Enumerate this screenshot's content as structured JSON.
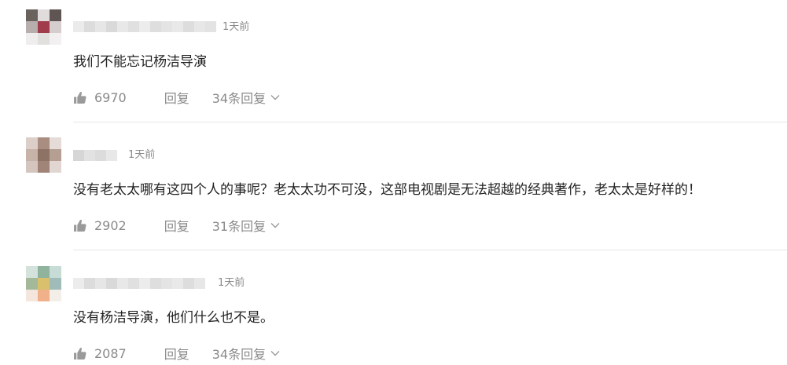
{
  "comments": [
    {
      "time": "1天前",
      "text": "我们不能忘记杨洁导演",
      "likes": "6970",
      "reply_label": "回复",
      "replies_label": "34条回复",
      "avatar_colors": [
        "#6a625c",
        "#e0dcdc",
        "#5f5653",
        "#b8aeae",
        "#a13c4c",
        "#d6cece",
        "#efeded",
        "#e2dfdf",
        "#f2f0f0"
      ],
      "name_colors": [
        "#ebebeb",
        "#dcdcdc",
        "#e6e6e6",
        "#d9d9d9",
        "#e8e8e8",
        "#e0e0e0",
        "#ececec",
        "#dedede",
        "#e4e4e4",
        "#e9e9e9",
        "#dddddd",
        "#e7e7e7",
        "#e3e3e3"
      ]
    },
    {
      "time": "1天前",
      "text": "没有老太太哪有这四个人的事呢？老太太功不可没，这部电视剧是无法超越的经典著作，老太太是好样的！",
      "likes": "2902",
      "reply_label": "回复",
      "replies_label": "31条回复",
      "avatar_colors": [
        "#dccfc9",
        "#a98d80",
        "#e5dcd8",
        "#c8b3a8",
        "#8c7366",
        "#b59e92",
        "#d4c6bf",
        "#a08478",
        "#e1d6d1"
      ],
      "name_colors": [
        "#d6d6d6",
        "#e2e2e2",
        "#dcdcdc",
        "#e8e8e8"
      ]
    },
    {
      "time": "1天前",
      "text": "没有杨洁导演，他们什么也不是。",
      "likes": "2087",
      "reply_label": "回复",
      "replies_label": "34条回复",
      "avatar_colors": [
        "#d4e2dc",
        "#8fb39d",
        "#c7dcd7",
        "#a4b89a",
        "#d8c06d",
        "#9fbcb8",
        "#f4e6dc",
        "#f0b08a",
        "#f4eee9"
      ],
      "name_colors": [
        "#ececec",
        "#dcdcdc",
        "#e6e6e6",
        "#d9d9d9",
        "#e8e8e8",
        "#e0e0e0",
        "#ececec",
        "#dedede",
        "#e4e4e4",
        "#e9e9e9",
        "#dddddd",
        "#e7e7e7"
      ]
    }
  ]
}
